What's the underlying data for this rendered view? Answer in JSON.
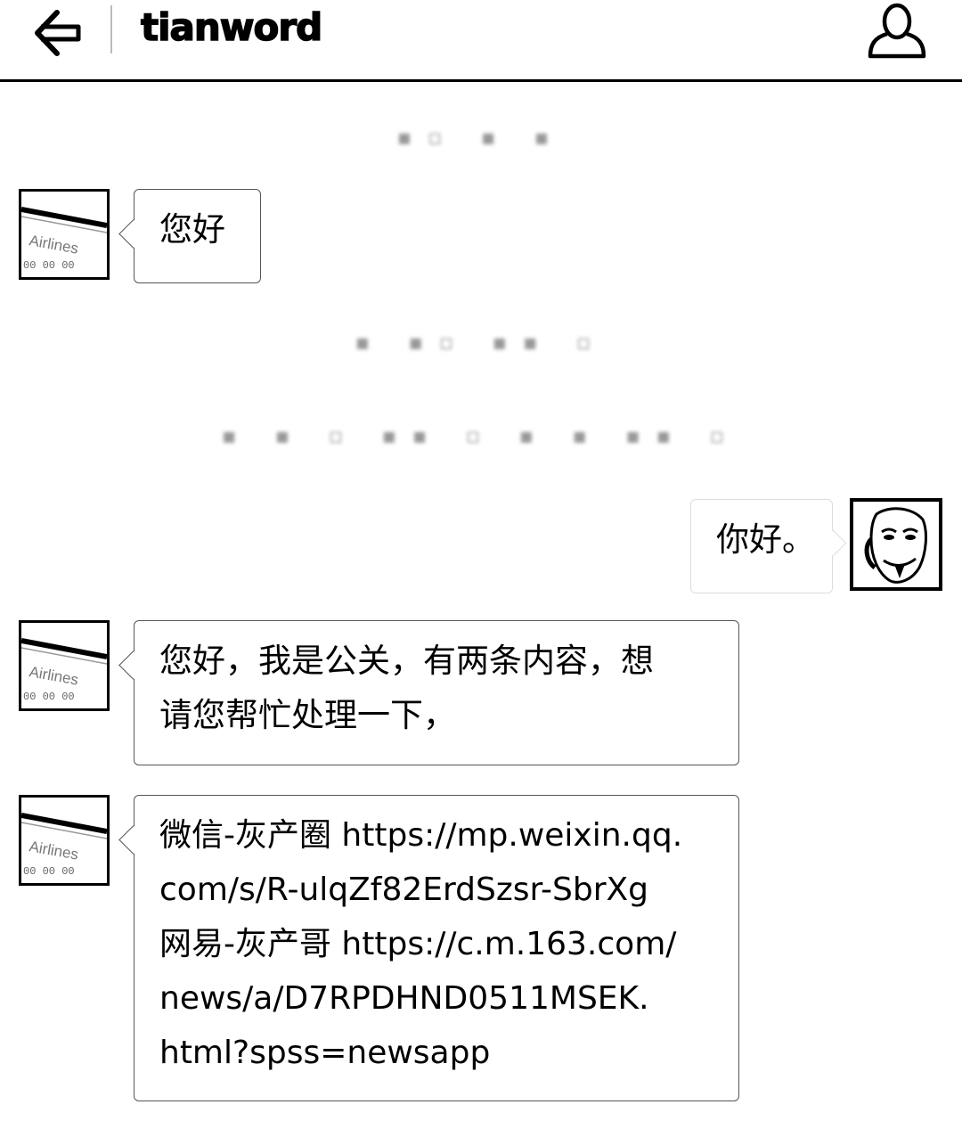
{
  "header": {
    "title": "tianword",
    "back_icon": "back-arrow-icon",
    "contact_icon": "person-icon"
  },
  "messages": [
    {
      "from": "other",
      "lines": [
        "您好"
      ]
    },
    {
      "from": "me",
      "lines": [
        "你好。"
      ]
    },
    {
      "from": "other",
      "lines": [
        "您好，我是公关，有两条内容，想",
        "请您帮忙处理一下，"
      ]
    },
    {
      "from": "other",
      "lines": [
        "微信-灰产圈 https://mp.weixin.qq.",
        "com/s/R-ulqZf82ErdSzsr-SbrXg",
        "网易-灰产哥 https://c.m.163.com/",
        "news/a/D7RPDHND0511MSEK.",
        "html?spss=newsapp"
      ]
    }
  ],
  "avatar_other": {
    "label": "Airlines"
  }
}
